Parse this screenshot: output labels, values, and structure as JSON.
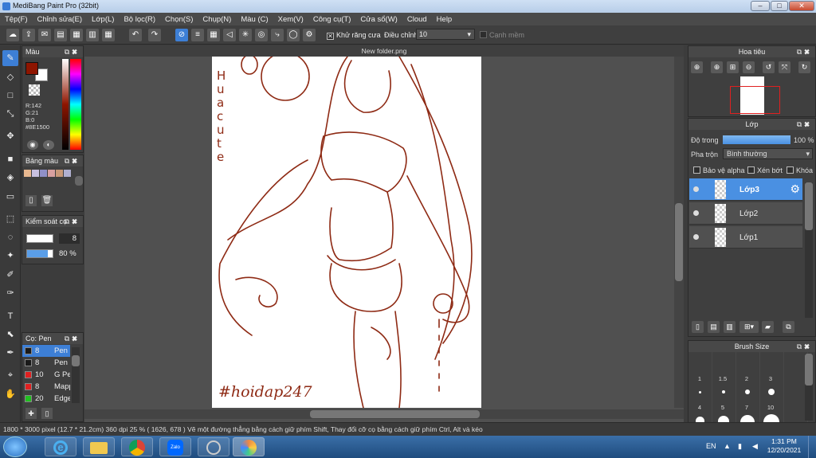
{
  "window": {
    "title": "MediBang Paint Pro (32bit)",
    "minimize": "–",
    "maximize": "□",
    "close": "✕"
  },
  "menu": [
    "Tệp(F)",
    "Chỉnh sửa(E)",
    "Lớp(L)",
    "Bộ lọc(R)",
    "Chọn(S)",
    "Chụp(N)",
    "Màu (C)",
    "Xem(V)",
    "Công cụ(T)",
    "Cửa sổ(W)",
    "Cloud",
    "Help"
  ],
  "toolbar": {
    "antialias_label": "Khử răng cưa",
    "adjust_label": "Điều chỉnh",
    "adjust_value": "10",
    "snap_label": "Cạnh mềm"
  },
  "color_panel": {
    "title": "Màu",
    "r": "R:142",
    "g": "G:21",
    "b": "B:0",
    "hex": "#8E1500",
    "primary": "#8e1500",
    "secondary": "#ffffff"
  },
  "palette_panel": {
    "title": "Bảng màu",
    "swatches": [
      "#e8b890",
      "#c8c0e0",
      "#9090c8",
      "#d8a0a0",
      "#c89878",
      "#b0b0d0"
    ]
  },
  "brush_control": {
    "title": "Kiểm soát cọ",
    "size": "8",
    "opacity": "80 %",
    "opacity_level": 0.8
  },
  "brush_panel": {
    "title": "Cọ: Pen",
    "rows": [
      {
        "size": "8",
        "name": "Pen",
        "color": "#1a1a1a",
        "selected": true
      },
      {
        "size": "8",
        "name": "Pen",
        "color": "#1a1a1a",
        "selected": false
      },
      {
        "size": "10",
        "name": "G Pen",
        "color": "#e02020",
        "selected": false
      },
      {
        "size": "8",
        "name": "Mapping Pen",
        "color": "#e02020",
        "selected": false
      },
      {
        "size": "20",
        "name": "Edge Pen",
        "color": "#20c020",
        "selected": false
      }
    ]
  },
  "document": {
    "tab": "New folder.png",
    "signature": "#hoidap247",
    "side_text": "Hua cute"
  },
  "navigator": {
    "title": "Hoa tiêu"
  },
  "layer_panel": {
    "title": "Lớp",
    "opacity_label": "Độ trong",
    "opacity_value": "100 %",
    "opacity_level": 1.0,
    "blend_label": "Pha trộn",
    "blend_value": "Bình thường",
    "protect_alpha": "Bảo vệ alpha",
    "clip": "Xén bớt",
    "lock": "Khóa",
    "layers": [
      {
        "name": "Lớp3",
        "selected": true
      },
      {
        "name": "Lớp2",
        "selected": false
      },
      {
        "name": "Lớp1",
        "selected": false
      }
    ]
  },
  "brush_size_panel": {
    "title": "Brush Size",
    "sizes": [
      "1",
      "1.5",
      "2",
      "3",
      "4",
      "5",
      "7",
      "10"
    ]
  },
  "status": {
    "text": "1800 * 3000 pixel  (12.7 * 21.2cm)  360 dpi  25 %  ( 1626, 678 )  Vẽ một đường thẳng bằng cách giữ phím Shift, Thay đổi cỡ cọ bằng cách giữ phím Ctrl, Alt và kéo"
  },
  "taskbar": {
    "lang": "EN",
    "time": "1:31 PM",
    "date": "12/20/2021",
    "apps": [
      "windows-start",
      "internet-explorer",
      "file-explorer",
      "chrome",
      "zalo",
      "paint-tool",
      "medibang"
    ]
  }
}
